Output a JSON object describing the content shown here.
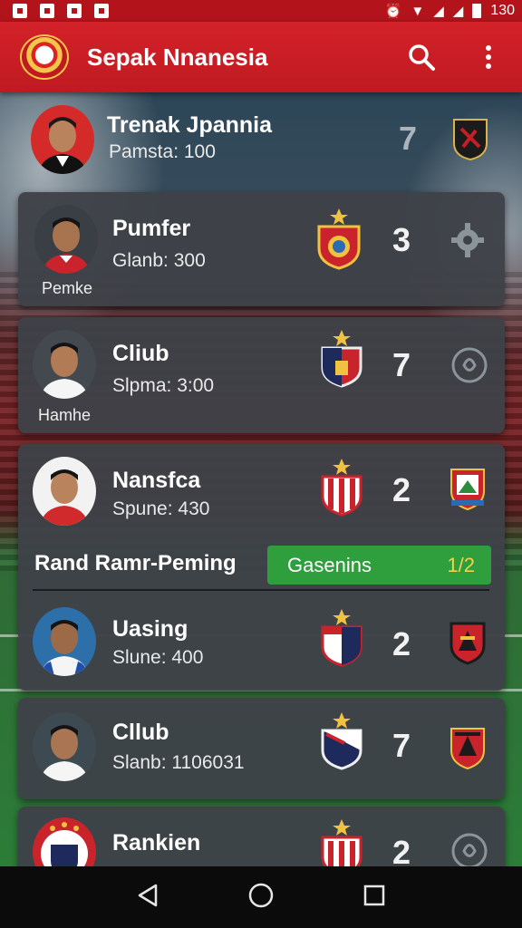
{
  "status_bar": {
    "time": "130"
  },
  "app": {
    "title": "Sepak Nnanesia"
  },
  "top_row": {
    "name": "Trenak Jpannia",
    "stat": "Pamsta: 100",
    "rank": "7"
  },
  "players": [
    {
      "name": "Pumfer",
      "stat": "Glanb: 300",
      "sub": "Pemke",
      "rank": "3"
    },
    {
      "name": "Cliub",
      "stat": "Slpma: 3:00",
      "sub": "Hamhe",
      "rank": "7"
    },
    {
      "name": "Nansfca",
      "stat": "Spune: 430",
      "rank": "2"
    },
    {
      "name": "Uasing",
      "stat": "Slune: 400",
      "rank": "2"
    },
    {
      "name": "Cllub",
      "stat": "Slanb: 1106031",
      "rank": "7"
    },
    {
      "name": "Rankien",
      "rank": "2"
    }
  ],
  "section": {
    "label": "Rand Ramr-Peming",
    "pill_label": "Gasenins",
    "pill_value": "1/2"
  },
  "colors": {
    "app_bar": "#c01a21",
    "card": "#3e4248",
    "pill": "#2f9e3c",
    "pill_value": "#f2d34a"
  }
}
